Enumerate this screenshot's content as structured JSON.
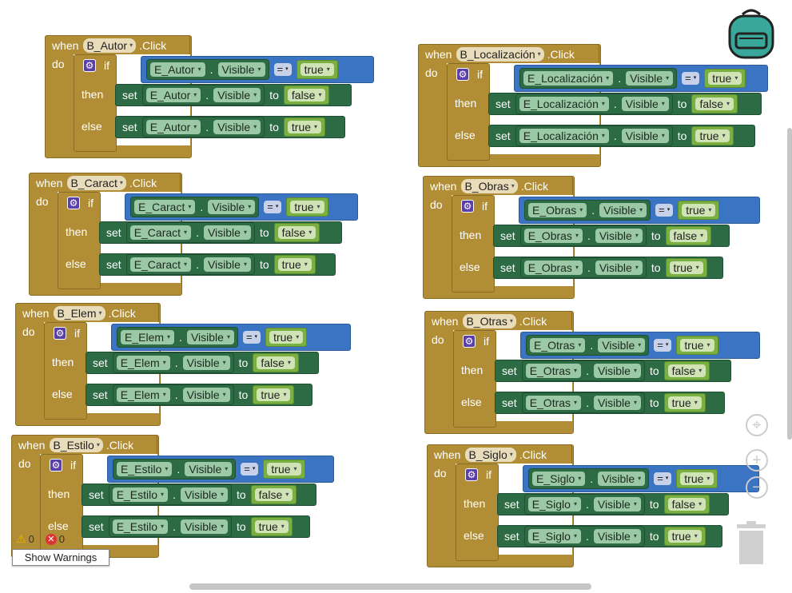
{
  "workspace": {
    "events": [
      {
        "component": "B_Autor",
        "event": ".Click",
        "target": "E_Autor"
      },
      {
        "component": "B_Caract",
        "event": ".Click",
        "target": "E_Caract"
      },
      {
        "component": "B_Elem",
        "event": ".Click",
        "target": "E_Elem"
      },
      {
        "component": "B_Estilo",
        "event": ".Click",
        "target": "E_Estilo"
      },
      {
        "component": "B_Localización",
        "event": ".Click",
        "target": "E_Localización"
      },
      {
        "component": "B_Obras",
        "event": ".Click",
        "target": "E_Obras"
      },
      {
        "component": "B_Otras",
        "event": ".Click",
        "target": "E_Otras"
      },
      {
        "component": "B_Siglo",
        "event": ".Click",
        "target": "E_Siglo"
      }
    ],
    "keywords": {
      "when": "when",
      "do": "do",
      "if": "if",
      "then": "then",
      "else": "else",
      "set": "set",
      "to": "to",
      "dot": "."
    },
    "property": "Visible",
    "operator": "=",
    "values": {
      "true": "true",
      "false": "false"
    }
  },
  "warnings": {
    "warning_count": "0",
    "error_count": "0",
    "button": "Show Warnings"
  },
  "icons": [
    "backpack-icon",
    "gear-icon",
    "warning-icon",
    "error-icon",
    "target-icon",
    "zoom-in-icon",
    "zoom-out-icon",
    "trash-icon"
  ]
}
